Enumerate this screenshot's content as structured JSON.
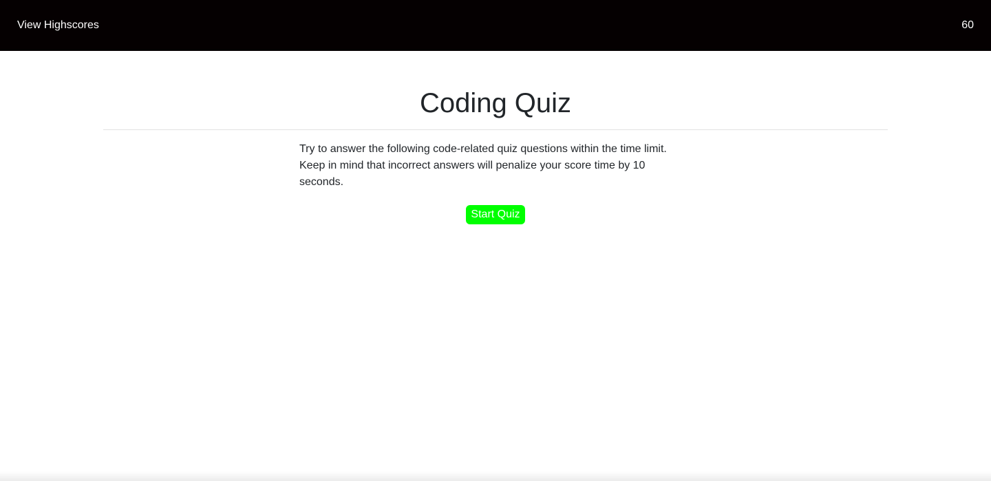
{
  "header": {
    "highscores_link": "View Highscores",
    "timer": "60",
    "background": "#050001"
  },
  "main": {
    "title": "Coding Quiz",
    "description": "Try to answer the following code-related quiz questions within the time limit. Keep in mind that incorrect answers will penalize your score time by 10 seconds.",
    "start_button_label": "Start Quiz",
    "start_button_color": "#00ff00"
  }
}
